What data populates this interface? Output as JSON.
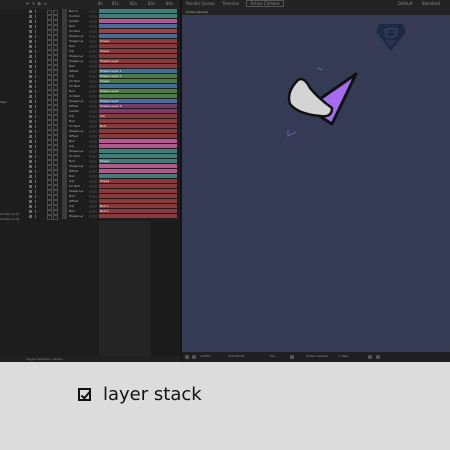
{
  "topbar": {
    "timeline_icons": "⌖ ✎ ◐ ▭",
    "ruler_labels": [
      "0s",
      "01s",
      "02s",
      "03s",
      "04s"
    ],
    "view_tabs": [
      "Render Queue",
      "Timeline",
      "Active Camera"
    ],
    "workspace": [
      "Default",
      "Standard"
    ]
  },
  "layers": {
    "side_labels": [
      "Main",
      "Control [1-2]",
      "Control [1-4]"
    ],
    "rows": [
      "Null 4",
      "Control",
      "Center",
      "Null",
      "CC Null",
      "Shape Lyr",
      "Shape Lyr",
      "Null",
      "Adj",
      "Shape Lyr",
      "Shape Lyr",
      "Null",
      "Offset",
      "Adj",
      "CC Null",
      "CC Null",
      "Null",
      "CC Null",
      "Shape Lyr",
      "Offset",
      "Center",
      "Adj",
      "Null",
      "CC Null",
      "Shape Lyr",
      "Offset",
      "Null",
      "Adj",
      "Shape Lyr",
      "CC Null",
      "Null",
      "Shape Lyr",
      "Offset",
      "Null",
      "Adj",
      "CC Null",
      "Shape Lyr",
      "Null",
      "Offset",
      "Adj",
      "Null",
      "Shape Lyr"
    ]
  },
  "tracks": [
    {
      "color": "#3e7f7a",
      "label": ""
    },
    {
      "color": "#3e7f7a",
      "label": ""
    },
    {
      "color": "#b7578f",
      "label": ""
    },
    {
      "color": "#3f6f9a",
      "label": ""
    },
    {
      "color": "#a04040",
      "label": ""
    },
    {
      "color": "#3f6f9a",
      "label": ""
    },
    {
      "color": "#8a3a3a",
      "label": "Shape"
    },
    {
      "color": "#8a3a3a",
      "label": ""
    },
    {
      "color": "#8a3a3a",
      "label": "Shape"
    },
    {
      "color": "#8a3a3a",
      "label": ""
    },
    {
      "color": "#8a3a3a",
      "label": "Shape Layer"
    },
    {
      "color": "#8a3a3a",
      "label": ""
    },
    {
      "color": "#3f6f9a",
      "label": "Shape Layer 1"
    },
    {
      "color": "#4e7a46",
      "label": "Shape Layer 2"
    },
    {
      "color": "#4e7a46",
      "label": "Shape"
    },
    {
      "color": "#3f6f9a",
      "label": ""
    },
    {
      "color": "#4e7a46",
      "label": "Shape Layer"
    },
    {
      "color": "#4e7a46",
      "label": ""
    },
    {
      "color": "#3f6f9a",
      "label": "Shape Layer"
    },
    {
      "color": "#7a3a6a",
      "label": "Shape Layer 5"
    },
    {
      "color": "#7a3a6a",
      "label": ""
    },
    {
      "color": "#8a3a3a",
      "label": "Adj"
    },
    {
      "color": "#8a3a3a",
      "label": ""
    },
    {
      "color": "#8a3a3a",
      "label": "Null"
    },
    {
      "color": "#8a3a3a",
      "label": ""
    },
    {
      "color": "#8a3a3a",
      "label": ""
    },
    {
      "color": "#b7578f",
      "label": ""
    },
    {
      "color": "#b7578f",
      "label": ""
    },
    {
      "color": "#3e7f7a",
      "label": ""
    },
    {
      "color": "#3e7f7a",
      "label": ""
    },
    {
      "color": "#3e7f7a",
      "label": "Shape"
    },
    {
      "color": "#b7578f",
      "label": ""
    },
    {
      "color": "#b7578f",
      "label": ""
    },
    {
      "color": "#3e7f7a",
      "label": ""
    },
    {
      "color": "#8a3a3a",
      "label": "Shape"
    },
    {
      "color": "#8a3a3a",
      "label": ""
    },
    {
      "color": "#8a3a3a",
      "label": ""
    },
    {
      "color": "#8a3a3a",
      "label": ""
    },
    {
      "color": "#8a3a3a",
      "label": ""
    },
    {
      "color": "#8a3a3a",
      "label": "Null 1"
    },
    {
      "color": "#8a3a3a",
      "label": "Null 2"
    },
    {
      "color": "#8a3a3a",
      "label": ""
    }
  ],
  "timeline_bottom": {
    "toggle_label": "Toggle Switches / Modes"
  },
  "viewer": {
    "title": "Active Camera",
    "bottom_items": [
      "(100%)",
      "0:00:00:00",
      "Full",
      "Active Camera",
      "1 View"
    ]
  },
  "caption": {
    "text": "layer stack"
  },
  "colors": {
    "comp_bg": "#353b55",
    "shape_purple": "#a56cf0",
    "shape_grey": "#d4d4d4",
    "logo": "#1e2946"
  }
}
